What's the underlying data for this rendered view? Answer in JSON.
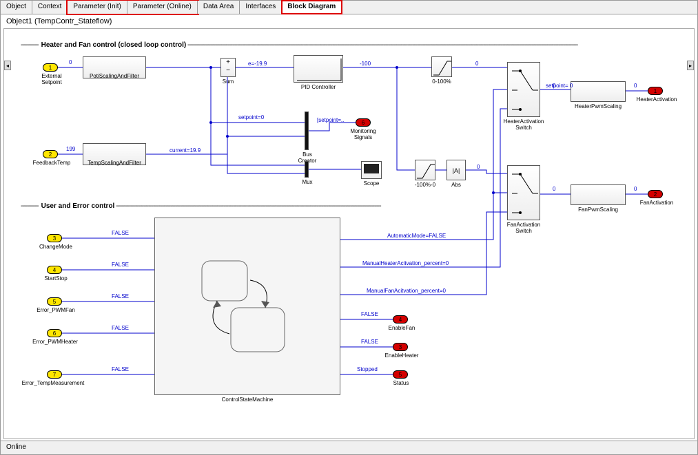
{
  "tabs": [
    "Object",
    "Context",
    "Parameter (Init)",
    "Parameter (Online)",
    "Data Area",
    "Interfaces",
    "Block Diagram"
  ],
  "active_tab": "Block Diagram",
  "title": "Object1 (TempContr_Stateflow)",
  "status": "Online",
  "section1": "Heater and Fan control (closed loop control)",
  "section2": "User and Error control",
  "ports_in": [
    {
      "n": "1",
      "label": "External Setpoint"
    },
    {
      "n": "2",
      "label": "FeedbackTemp"
    },
    {
      "n": "3",
      "label": "ChangeMode"
    },
    {
      "n": "4",
      "label": "StartStop"
    },
    {
      "n": "5",
      "label": "Error_PWMFan"
    },
    {
      "n": "6",
      "label": "Error_PWMHeater"
    },
    {
      "n": "7",
      "label": "Error_TempMeasurement"
    }
  ],
  "ports_out": [
    {
      "n": "1",
      "label": "HeaterActivation"
    },
    {
      "n": "2",
      "label": "FanActivation"
    },
    {
      "n": "6",
      "label": "Monitoring Signals"
    },
    {
      "n": "4",
      "label": "EnableFan"
    },
    {
      "n": "3",
      "label": "EnableHeater"
    },
    {
      "n": "5",
      "label": "Status"
    }
  ],
  "blocks": {
    "potiScaling": "PotiScalingAndFilter",
    "tempScaling": "TempScalingAndFilter",
    "sum": "Sum",
    "pid": "PID Controller",
    "sat1": "0-100%",
    "sat2": "-100%-0",
    "abs": "Abs",
    "heaterSwitch": "HeaterActivation Switch",
    "fanSwitch": "FanActivation Switch",
    "heaterPwm": "HeaterPwmScaling",
    "fanPwm": "FanPwmScaling",
    "bus": "Bus Creator",
    "mux": "Mux",
    "scope": "Scope",
    "csm": "ControlStateMachine"
  },
  "signals": {
    "zero_in": "0",
    "fb199": "199",
    "current": "current=19.9",
    "setpoint0": "setpoint=0",
    "e": "e=-19.9",
    "pidout": "-100",
    "satout0": "0",
    "heaterOut0": "0",
    "fanOut0": "0",
    "setpointbr": "[setpoint=..",
    "setpointSw": "setpoint= 0",
    "autoMode": "AutomaticMode=FALSE",
    "manHeater": "ManualHeaterAcitvation_percent=0",
    "manFan": "ManualFanAcitvation_percent=0",
    "false": "FALSE",
    "stopped": "Stopped",
    "absLbl": "|A|"
  }
}
